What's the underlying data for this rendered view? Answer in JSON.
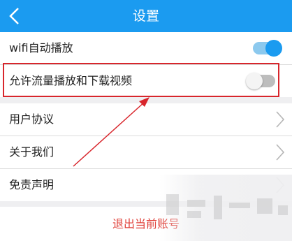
{
  "header": {
    "title": "设置",
    "back_icon": "chevron-left-icon"
  },
  "settings": [
    {
      "label": "wifi自动播放",
      "toggle": "on"
    },
    {
      "label": "允许流量播放和下载视频",
      "toggle": "off"
    }
  ],
  "menu": [
    {
      "label": "用户协议",
      "icon": "chevron-right-icon"
    },
    {
      "label": "关于我们",
      "icon": "chevron-right-icon"
    },
    {
      "label": "免责声明",
      "icon": "chevron-right-icon"
    }
  ],
  "logout_label": "退出当前账号",
  "colors": {
    "header": "#1b9bf0",
    "toggle_on": "#1b9bf0",
    "highlight": "#d8262c",
    "logout": "#e0413a"
  }
}
